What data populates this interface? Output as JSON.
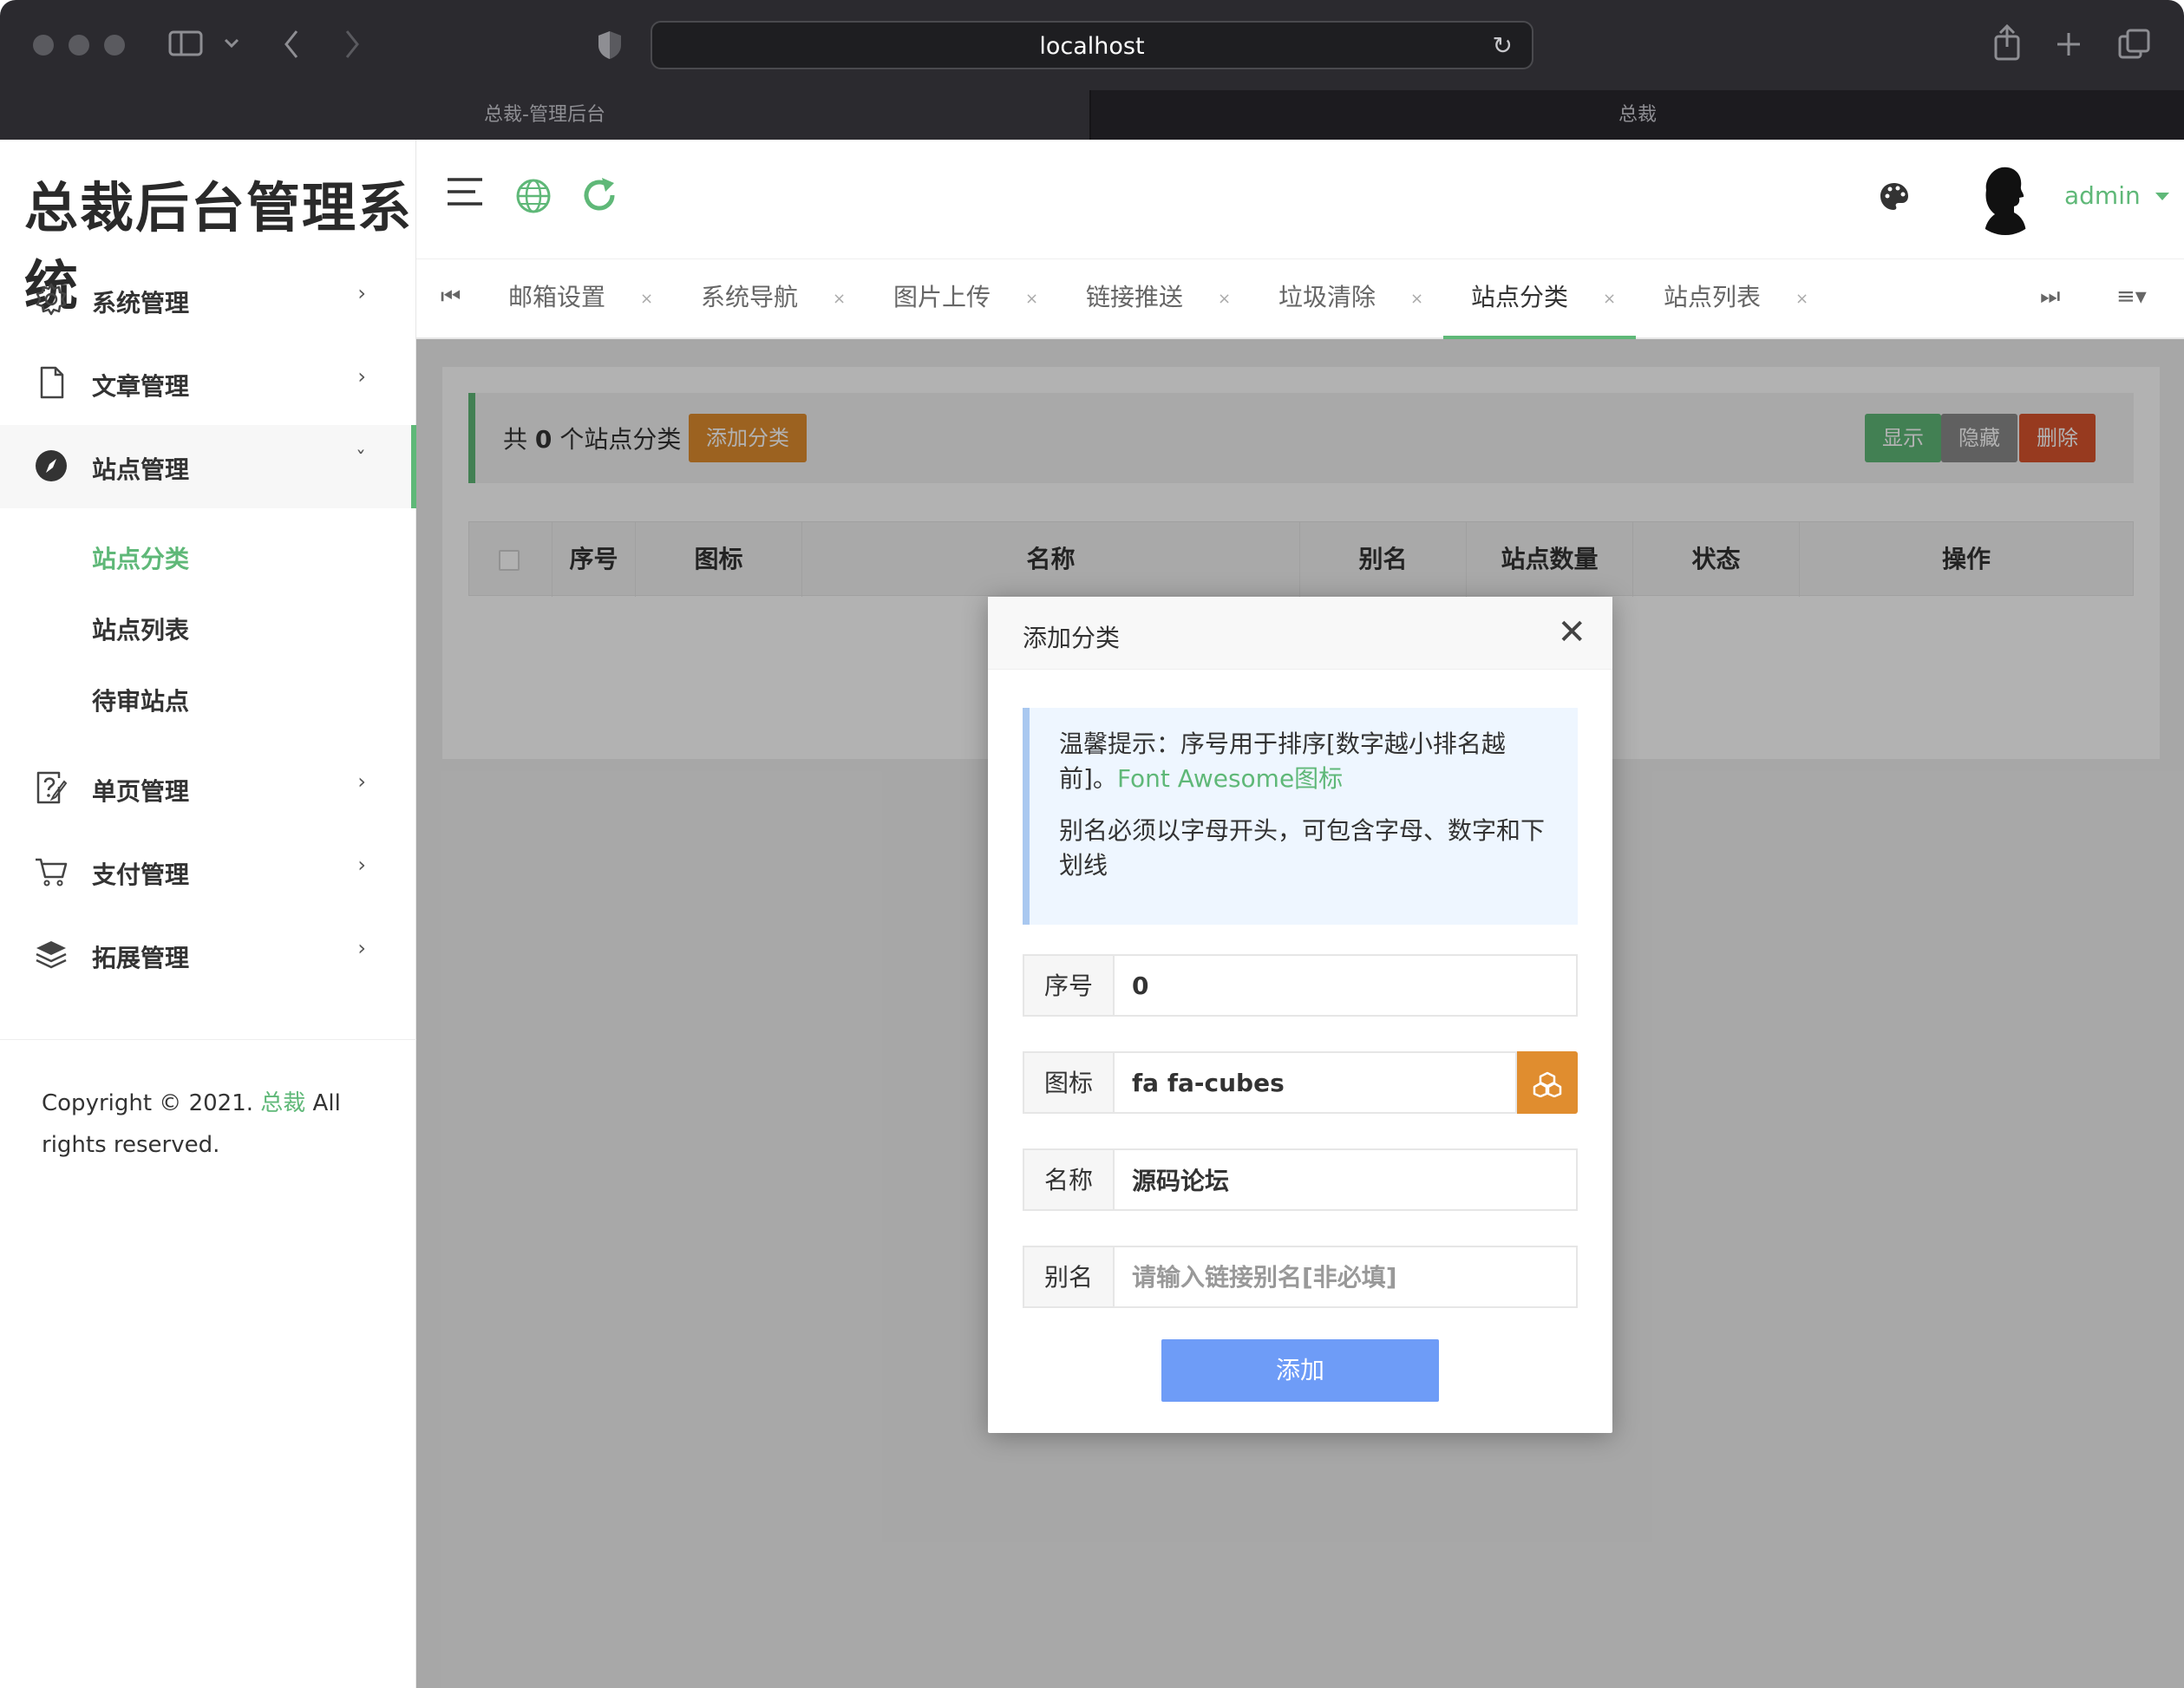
{
  "browser": {
    "url": "localhost",
    "tabs": [
      "总裁-管理后台",
      "总裁"
    ]
  },
  "app": {
    "logo": "总裁后台管理系统",
    "username": "admin",
    "colors": {
      "accent": "#5fb878",
      "warm": "#e08d2f",
      "danger": "#d9542d",
      "primary_btn": "#6e9cf7"
    }
  },
  "sidebar": {
    "menu": [
      {
        "label": "系统管理",
        "icon": "gear-icon",
        "arrow": "›"
      },
      {
        "label": "文章管理",
        "icon": "document-icon",
        "arrow": "›"
      },
      {
        "label": "站点管理",
        "icon": "compass-icon",
        "arrow": "ˇ"
      },
      {
        "label": "单页管理",
        "icon": "page-edit-icon",
        "arrow": "›"
      },
      {
        "label": "支付管理",
        "icon": "cart-icon",
        "arrow": "›"
      },
      {
        "label": "拓展管理",
        "icon": "layers-icon",
        "arrow": "›"
      }
    ],
    "submenu": [
      "站点分类",
      "站点列表",
      "待审站点"
    ],
    "copyright_prefix": "Copyright © 2021. ",
    "copyright_brand": "总裁",
    "copyright_suffix": " All rights reserved."
  },
  "page_tabs": [
    {
      "label": "邮箱设置",
      "close": "×"
    },
    {
      "label": "系统导航",
      "close": "×"
    },
    {
      "label": "图片上传",
      "close": "×"
    },
    {
      "label": "链接推送",
      "close": "×"
    },
    {
      "label": "垃圾清除",
      "close": "×"
    },
    {
      "label": "站点分类",
      "close": "×"
    },
    {
      "label": "站点列表",
      "close": "×"
    }
  ],
  "content": {
    "count_prefix": "共",
    "count": "0",
    "count_suffix": "个站点分类",
    "add_button": "添加分类",
    "show_button": "显示",
    "hide_button": "隐藏",
    "delete_button": "删除",
    "columns": [
      "序号",
      "图标",
      "名称",
      "别名",
      "站点数量",
      "状态",
      "操作"
    ]
  },
  "modal": {
    "title": "添加分类",
    "close": "✕",
    "tip_line1": "温馨提示：序号用于排序[数字越小排名越前]。",
    "tip_link": "Font Awesome图标",
    "tip_line2": "别名必须以字母开头，可包含字母、数字和下划线",
    "fields": {
      "order_label": "序号",
      "order_value": "0",
      "icon_label": "图标",
      "icon_value": "fa fa-cubes",
      "name_label": "名称",
      "name_value": "源码论坛",
      "alias_label": "别名",
      "alias_placeholder": "请输入链接别名[非必填]"
    },
    "submit": "添加"
  }
}
